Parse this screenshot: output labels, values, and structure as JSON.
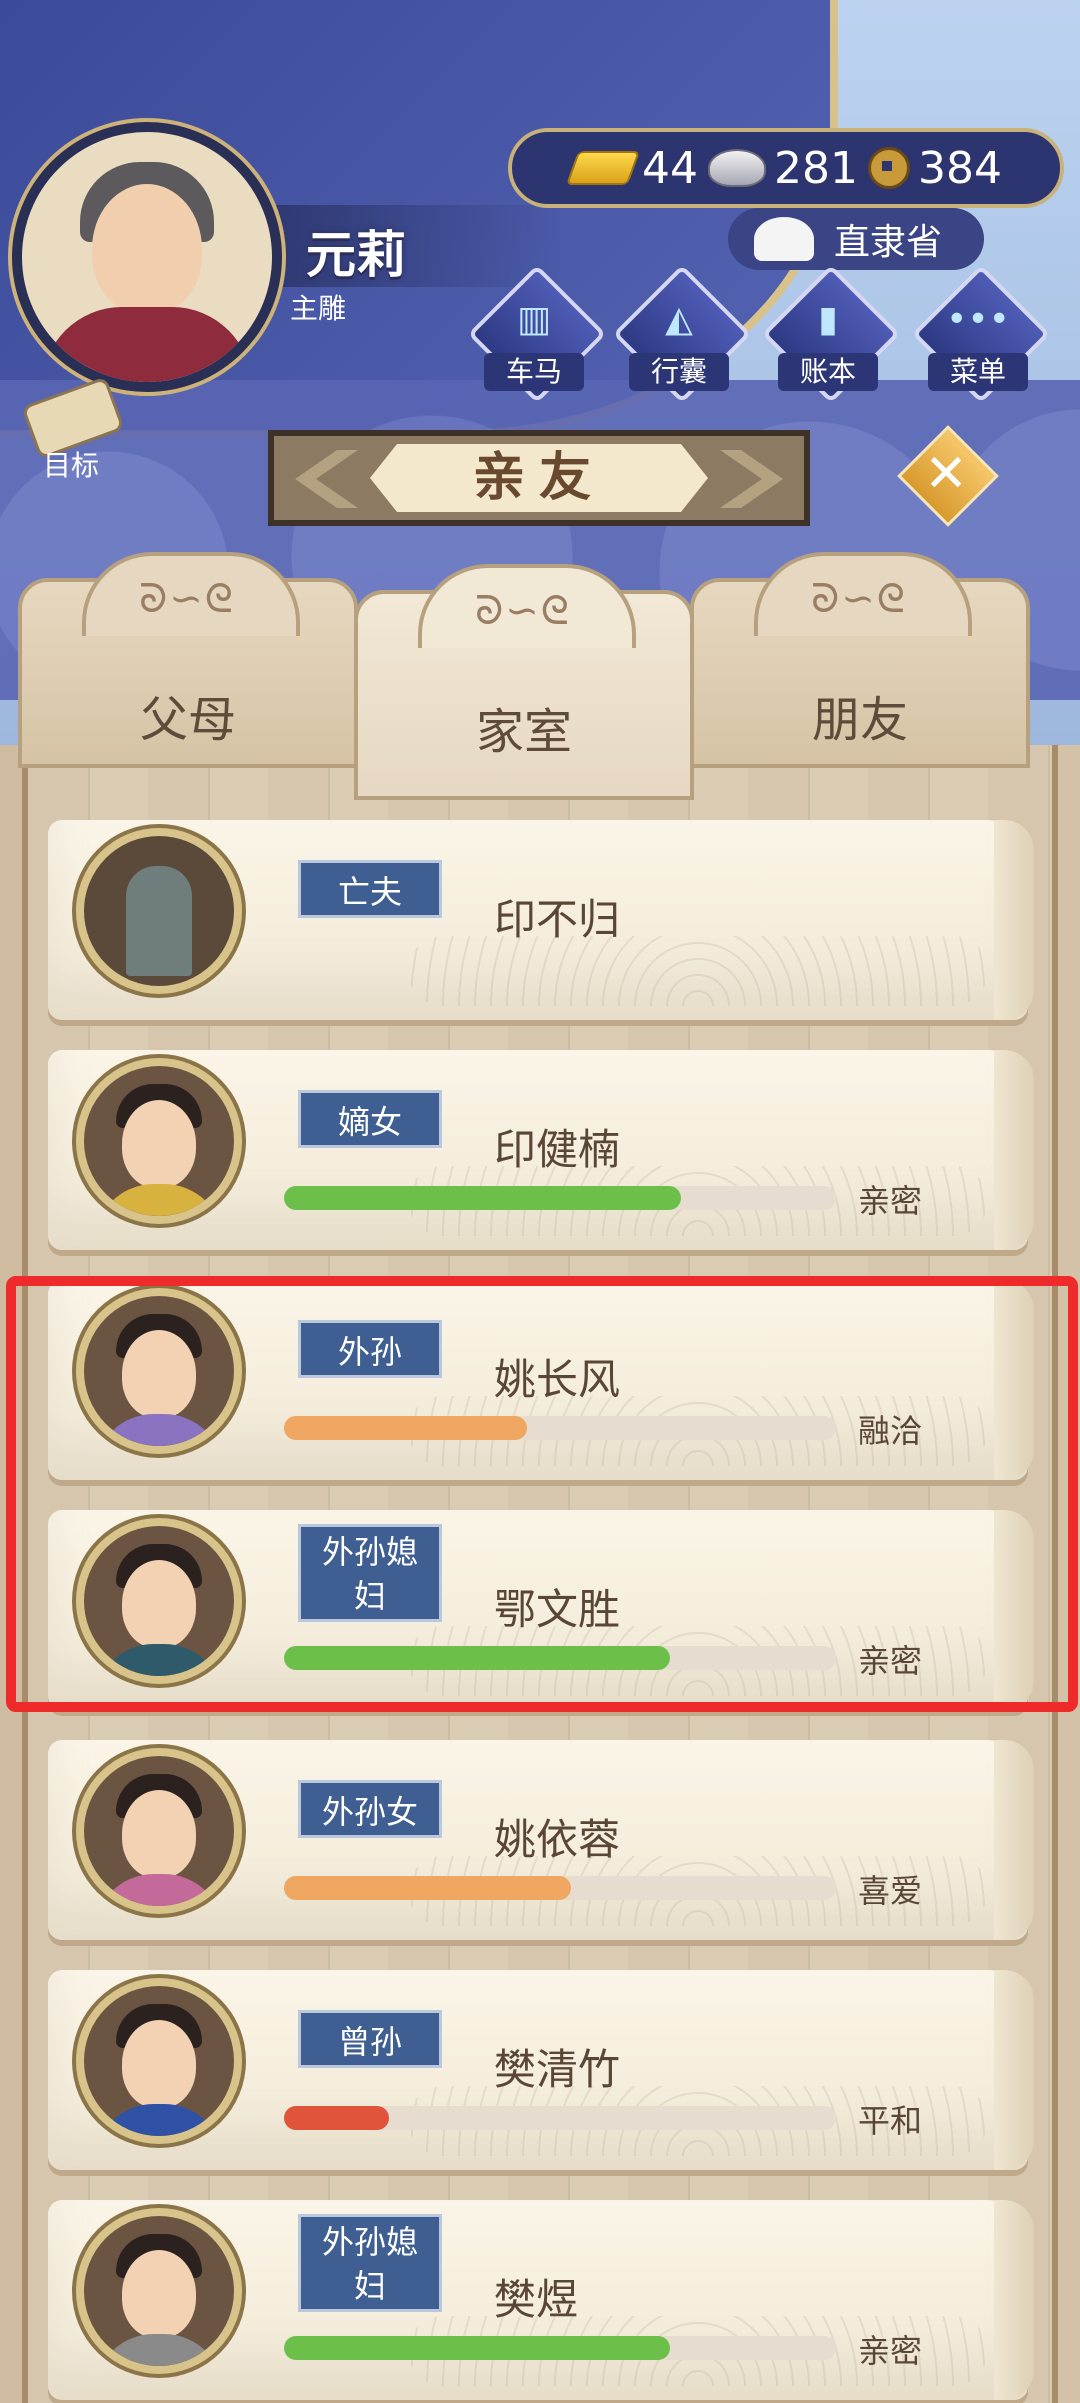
{
  "header": {
    "player_name": "元莉",
    "player_role": "主雕",
    "currency": {
      "gold": "44",
      "silver": "281",
      "coin": "384"
    },
    "location": "直隶省",
    "nav": [
      {
        "label": "车马",
        "icon": "carriage-icon",
        "glyph": "▥"
      },
      {
        "label": "行囊",
        "icon": "bag-icon",
        "glyph": "◭"
      },
      {
        "label": "账本",
        "icon": "ledger-icon",
        "glyph": "▮"
      },
      {
        "label": "菜单",
        "icon": "menu-dots-icon",
        "glyph": "•••"
      }
    ],
    "goal_label": "目标"
  },
  "panel": {
    "title": "亲友",
    "close_glyph": "✕",
    "tabs": [
      {
        "label": "父母",
        "active": false
      },
      {
        "label": "家室",
        "active": true
      },
      {
        "label": "朋友",
        "active": false
      }
    ],
    "swirl": "ᘐ∽ᘓ"
  },
  "members": [
    {
      "relation": "亡夫",
      "name": "印不归",
      "bar": null,
      "mood": ""
    },
    {
      "relation": "嫡女",
      "name": "印健楠",
      "bar": {
        "value": 0.72,
        "color": "#6cc04a"
      },
      "mood": "亲密"
    },
    {
      "relation": "外孙",
      "name": "姚长风",
      "bar": {
        "value": 0.44,
        "color": "#eea660"
      },
      "mood": "融洽"
    },
    {
      "relation": "外孙媳妇",
      "relation_lines": [
        "外孙媳",
        "妇"
      ],
      "name": "鄂文胜",
      "bar": {
        "value": 0.7,
        "color": "#6cc04a"
      },
      "mood": "亲密"
    },
    {
      "relation": "外孙女",
      "name": "姚依蓉",
      "bar": {
        "value": 0.52,
        "color": "#eea660"
      },
      "mood": "喜爱"
    },
    {
      "relation": "曾孙",
      "name": "樊清竹",
      "bar": {
        "value": 0.19,
        "color": "#e0543c"
      },
      "mood": "平和"
    },
    {
      "relation": "外孙媳妇",
      "relation_lines": [
        "外孙媳",
        "妇"
      ],
      "name": "樊煜",
      "bar": {
        "value": 0.7,
        "color": "#6cc04a"
      },
      "mood": "亲密"
    }
  ],
  "colors": {
    "highlight": "#ee2a2a",
    "banner": "#3c4a9a"
  }
}
